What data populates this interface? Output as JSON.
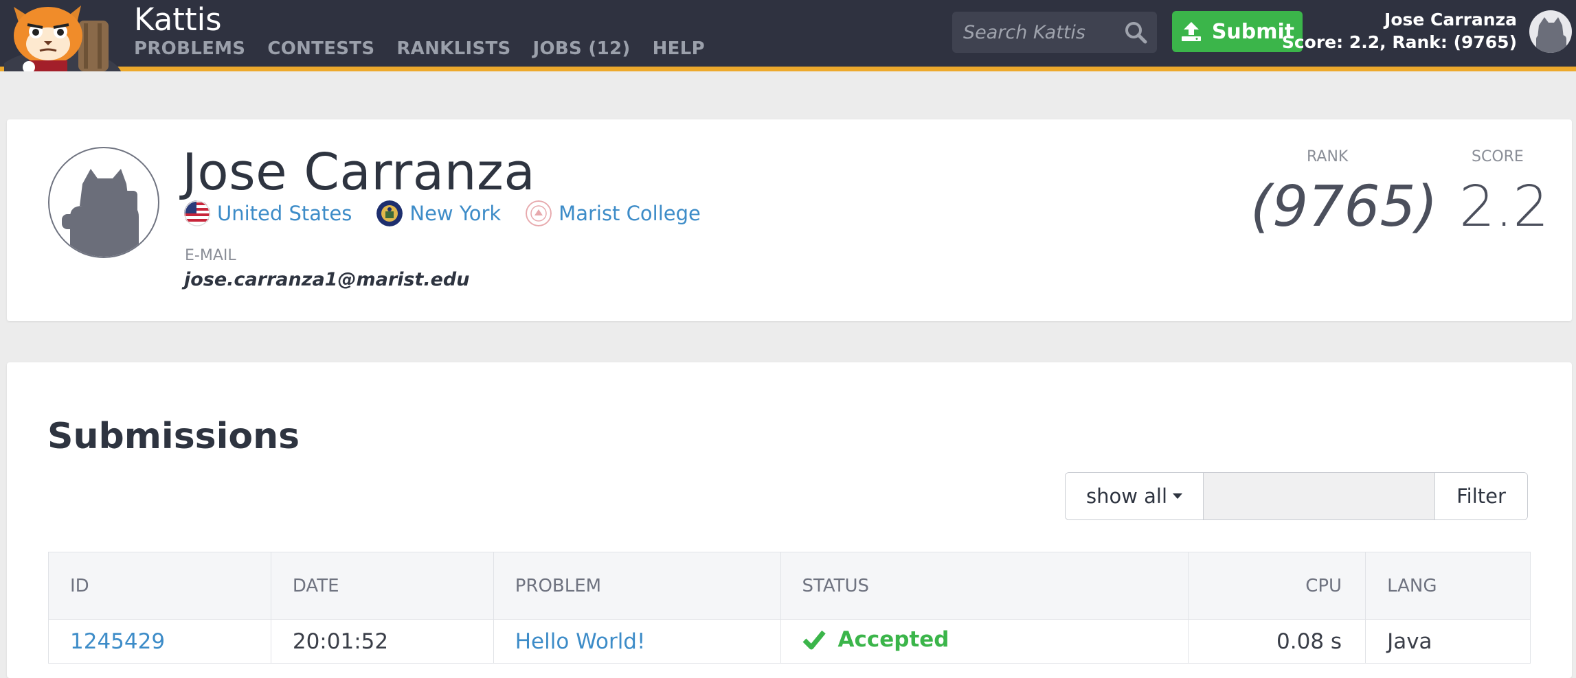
{
  "header": {
    "brand": "Kattis",
    "nav": [
      "PROBLEMS",
      "CONTESTS",
      "RANKLISTS",
      "JOBS (12)",
      "HELP"
    ],
    "search_placeholder": "Search Kattis",
    "submit_label": "Submit",
    "user_name": "Jose Carranza",
    "user_stats": "Score: 2.2, Rank: (9765)"
  },
  "profile": {
    "name": "Jose Carranza",
    "country": "United States",
    "region": "New York",
    "school": "Marist College",
    "email_label": "E-MAIL",
    "email": "jose.carranza1@marist.edu",
    "rank_label": "RANK",
    "rank": "(9765)",
    "score_label": "SCORE",
    "score": "2.2"
  },
  "submissions": {
    "title": "Submissions",
    "filter_select": "show all",
    "filter_button": "Filter",
    "columns": [
      "ID",
      "DATE",
      "PROBLEM",
      "STATUS",
      "CPU",
      "LANG"
    ],
    "rows": [
      {
        "id": "1245429",
        "date": "20:01:52",
        "problem": "Hello World!",
        "status": "Accepted",
        "cpu": "0.08 s",
        "lang": "Java"
      }
    ]
  },
  "colors": {
    "topbar": "#2f3240",
    "accent_bar": "#eda92c",
    "submit_green": "#3bb54a",
    "link_blue": "#3d8cc8"
  },
  "icons": [
    "kattis-logo",
    "search-icon",
    "upload-icon",
    "avatar",
    "us-flag-icon",
    "new-york-seal-icon",
    "marist-seal-icon",
    "check-icon"
  ]
}
